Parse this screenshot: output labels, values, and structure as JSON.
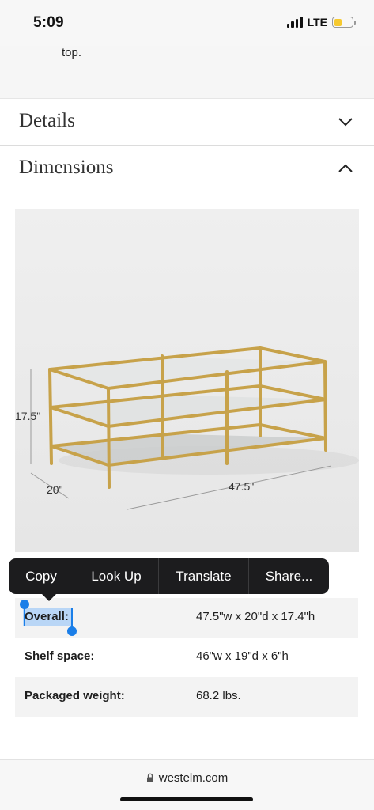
{
  "status_bar": {
    "time": "5:09",
    "network": "LTE",
    "battery_level": 0.45,
    "battery_color": "#f6c92f"
  },
  "snippet": {
    "text": "top."
  },
  "accordions": {
    "details": {
      "title": "Details",
      "icon": "chevron-down-icon",
      "expanded": false
    },
    "dimensions": {
      "title": "Dimensions",
      "icon": "chevron-up-icon",
      "expanded": true
    }
  },
  "product_image": {
    "height_label": "17.5\"",
    "depth_label": "20\"",
    "width_label": "47.5\"",
    "frame_color": "#c7a24a"
  },
  "context_menu": {
    "items": [
      "Copy",
      "Look Up",
      "Translate",
      "Share..."
    ]
  },
  "specs": {
    "rows": [
      {
        "label": "Overall:",
        "value": "47.5\"w x 20\"d x 17.4\"h",
        "selected": true
      },
      {
        "label": "Shelf space:",
        "value": "46\"w x 19\"d x 6\"h",
        "selected": false
      },
      {
        "label": "Packaged weight:",
        "value": "68.2 lbs.",
        "selected": false
      }
    ],
    "selection_color": "#b9d6f6",
    "handle_color": "#1a7ee8"
  },
  "url_bar": {
    "url": "westelm.com",
    "icon": "lock-icon"
  }
}
